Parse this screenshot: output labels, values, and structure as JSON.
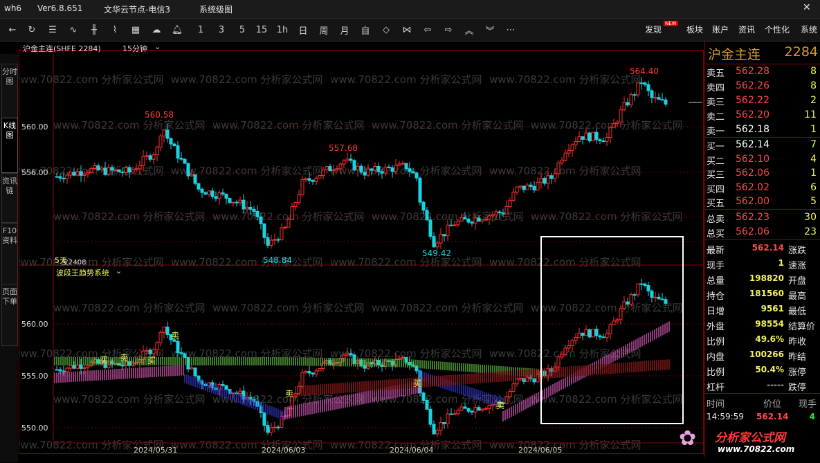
{
  "titlebar": {
    "app": "wh6",
    "version": "Ver6.8.651",
    "server": "文华云节点-电信3",
    "menu": "系统级图"
  },
  "toolbar": {
    "nav_icons": [
      "back-arrow-icon",
      "refresh-icon",
      "list-icon",
      "line-chart-icon",
      "candlestick-icon",
      "tick-chart-icon",
      "calculator-icon",
      "cloud-icon",
      "bell-icon"
    ],
    "periods": [
      "1",
      "3",
      "5",
      "15",
      "1h",
      "日",
      "周",
      "月",
      "自"
    ],
    "tools": [
      "expand-icon",
      "shrink-icon",
      "left-icon",
      "right-icon",
      "up-icon",
      "down-icon",
      "more-icon"
    ],
    "right": [
      {
        "label": "发现",
        "badge": "NEW"
      },
      {
        "label": "板块"
      },
      {
        "label": "账户"
      },
      {
        "label": "资讯"
      },
      {
        "label": "个性化"
      },
      {
        "label": "系统"
      }
    ]
  },
  "side_tabs": [
    "分时图",
    "K线图",
    "资讯链",
    "F10资料",
    "页面下单"
  ],
  "chart": {
    "header": {
      "symbol": "沪金主连(SHFE 2284)",
      "period": "15分钟"
    },
    "main_y_ticks": [
      "560.00",
      "556.00"
    ],
    "main_annotations": [
      "560.58",
      "557.68",
      "548.84",
      "549.42",
      "564.40"
    ],
    "sub_header": {
      "indicator": "波段王趋势系统",
      "period_tag": "5天",
      "extra": "全2408"
    },
    "sub_y_ticks": [
      "560.00",
      "555.00",
      "550.00"
    ],
    "signals": [
      "卖",
      "买",
      "卖",
      "买",
      "卖",
      "买",
      "卖"
    ],
    "x_labels": [
      "2024/05/31",
      "2024/06/03",
      "2024/06/04",
      "2024/06/05"
    ],
    "watermark_text": "www.70822.com  分析家公式网",
    "colors": {
      "up": "#ff3030",
      "down": "#19d3e0",
      "green_band": "#66c44a",
      "blue_band": "#3b3bd9",
      "pink_band": "#e060c0",
      "dark_red_band": "#a52222"
    }
  },
  "chart_data": {
    "type": "candlestick",
    "symbol": "沪金主连",
    "x": [
      "2024/05/31",
      "2024/06/03",
      "2024/06/04",
      "2024/06/05"
    ],
    "ylim": [
      546,
      566
    ],
    "labels": {
      "high_1": 560.58,
      "high_2": 557.68,
      "low_1": 548.84,
      "low_2": 549.42,
      "high_3": 564.4
    }
  },
  "quote": {
    "name": "沪金主连",
    "code": "2284",
    "asks": [
      {
        "label": "卖五",
        "price": "562.28",
        "vol": "8"
      },
      {
        "label": "卖四",
        "price": "562.26",
        "vol": "8"
      },
      {
        "label": "卖三",
        "price": "562.22",
        "vol": "2"
      },
      {
        "label": "卖二",
        "price": "562.20",
        "vol": "11"
      },
      {
        "label": "卖一",
        "price": "562.18",
        "vol": "1"
      }
    ],
    "bids": [
      {
        "label": "买一",
        "price": "562.14",
        "vol": "7"
      },
      {
        "label": "买二",
        "price": "562.10",
        "vol": "4"
      },
      {
        "label": "买三",
        "price": "562.06",
        "vol": "1"
      },
      {
        "label": "买四",
        "price": "562.02",
        "vol": "6"
      },
      {
        "label": "买五",
        "price": "562.00",
        "vol": "5"
      }
    ],
    "totals": [
      {
        "label": "总卖",
        "price": "562.23",
        "vol": "30"
      },
      {
        "label": "总买",
        "price": "562.06",
        "vol": "23"
      }
    ],
    "stats": [
      {
        "l1": "最新",
        "v1": "562.14",
        "c": "#ff4848",
        "l2": "涨跌"
      },
      {
        "l1": "现手",
        "v1": "1",
        "c": "#f2f25a",
        "l2": "速涨"
      },
      {
        "l1": "总量",
        "v1": "198820",
        "c": "#f2f25a",
        "l2": "开盘"
      },
      {
        "l1": "持仓",
        "v1": "181560",
        "c": "#f2f25a",
        "l2": "最高"
      },
      {
        "l1": "日增",
        "v1": "9561",
        "c": "#f2f25a",
        "l2": "最低"
      },
      {
        "l1": "外盘",
        "v1": "98554",
        "c": "#f2f25a",
        "l2": "结算价"
      },
      {
        "l1": "比例",
        "v1": "49.6%",
        "c": "#f2f25a",
        "l2": "昨收"
      },
      {
        "l1": "内盘",
        "v1": "100266",
        "c": "#f2f25a",
        "l2": "昨结"
      },
      {
        "l1": "比例",
        "v1": "50.4%",
        "c": "#f2f25a",
        "l2": "涨停"
      },
      {
        "l1": "杠杆",
        "v1": "-----",
        "c": "#aaaaaa",
        "l2": "跌停"
      }
    ],
    "ticks_header": [
      "时间",
      "价位",
      "现手"
    ],
    "ticks": [
      {
        "time": "14:59:59",
        "price": "562.14",
        "vol": "4"
      }
    ]
  },
  "logo": {
    "text": "分析家公式网",
    "url": "www.70822.com"
  }
}
